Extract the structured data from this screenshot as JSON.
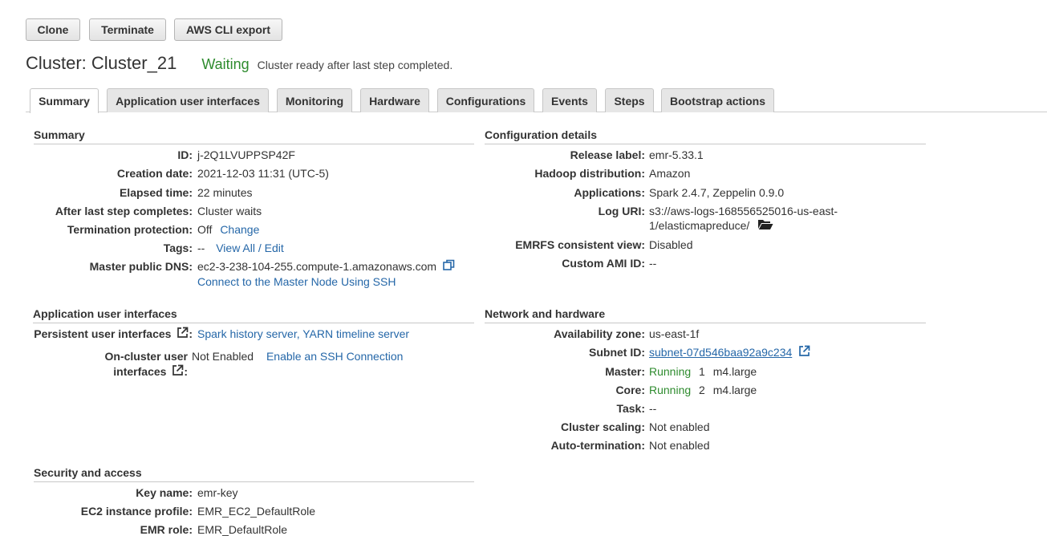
{
  "toolbar": {
    "clone": "Clone",
    "terminate": "Terminate",
    "cli_export": "AWS CLI export"
  },
  "header": {
    "title": "Cluster: Cluster_21",
    "status": "Waiting",
    "status_message": "Cluster ready after last step completed."
  },
  "tabs": [
    "Summary",
    "Application user interfaces",
    "Monitoring",
    "Hardware",
    "Configurations",
    "Events",
    "Steps",
    "Bootstrap actions"
  ],
  "summary": {
    "heading": "Summary",
    "id_label": "ID:",
    "id_value": "j-2Q1LVUPPSP42F",
    "creation_label": "Creation date:",
    "creation_value": "2021-12-03 11:31 (UTC-5)",
    "elapsed_label": "Elapsed time:",
    "elapsed_value": "22 minutes",
    "after_step_label": "After last step completes:",
    "after_step_value": "Cluster waits",
    "termination_label": "Termination protection:",
    "termination_value": "Off",
    "termination_link": "Change",
    "tags_label": "Tags:",
    "tags_value": "--",
    "tags_link": "View All / Edit",
    "dns_label": "Master public DNS:",
    "dns_value": "ec2-3-238-104-255.compute-1.amazonaws.com",
    "ssh_link": "Connect to the Master Node Using SSH"
  },
  "app_ui": {
    "heading": "Application user interfaces",
    "persistent_label": "Persistent user interfaces",
    "persistent_value": "Spark history server, YARN timeline server",
    "oncluster_label_1": "On-cluster user",
    "oncluster_label_2": "interfaces",
    "oncluster_value": "Not Enabled",
    "oncluster_link": "Enable an SSH Connection"
  },
  "security": {
    "heading": "Security and access",
    "key_label": "Key name:",
    "key_value": "emr-key",
    "profile_label": "EC2 instance profile:",
    "profile_value": "EMR_EC2_DefaultRole",
    "role_label": "EMR role:",
    "role_value": "EMR_DefaultRole"
  },
  "config": {
    "heading": "Configuration details",
    "release_label": "Release label:",
    "release_value": "emr-5.33.1",
    "hadoop_label": "Hadoop distribution:",
    "hadoop_value": "Amazon",
    "apps_label": "Applications:",
    "apps_value": "Spark 2.4.7, Zeppelin 0.9.0",
    "log_label": "Log URI:",
    "log_value_1": "s3://aws-logs-168556525016-us-east-",
    "log_value_2": "1/elasticmapreduce/",
    "emrfs_label": "EMRFS consistent view:",
    "emrfs_value": "Disabled",
    "ami_label": "Custom AMI ID:",
    "ami_value": "--"
  },
  "network": {
    "heading": "Network and hardware",
    "az_label": "Availability zone:",
    "az_value": "us-east-1f",
    "subnet_label": "Subnet ID:",
    "subnet_value": "subnet-07d546baa92a9c234",
    "master_label": "Master:",
    "master_status": "Running",
    "master_count": "1",
    "master_type": "m4.large",
    "core_label": "Core:",
    "core_status": "Running",
    "core_count": "2",
    "core_type": "m4.large",
    "task_label": "Task:",
    "task_value": "--",
    "scaling_label": "Cluster scaling:",
    "scaling_value": "Not enabled",
    "autoterm_label": "Auto-termination:",
    "autoterm_value": "Not enabled"
  },
  "colors": {
    "link": "#2567a8",
    "success": "#2e8b2e"
  }
}
